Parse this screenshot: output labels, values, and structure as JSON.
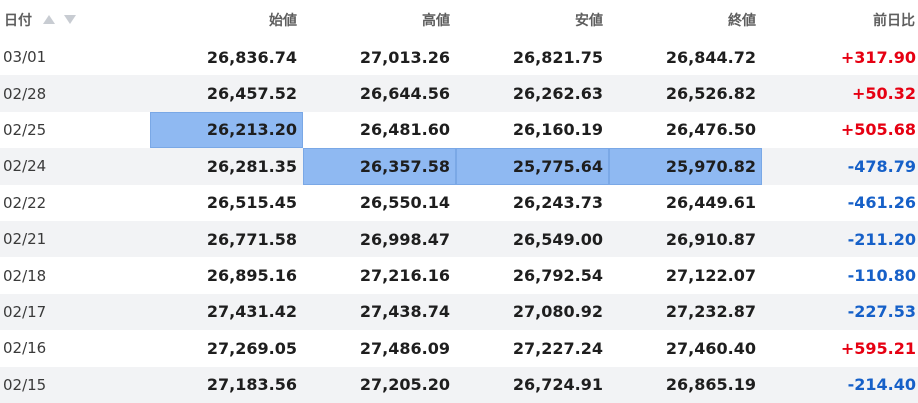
{
  "colors": {
    "up": "#e60012",
    "down": "#1660c8",
    "highlight": "#8fb9f2",
    "stripe": "#f2f3f5"
  },
  "table": {
    "headers": {
      "date": "日付",
      "open": "始値",
      "high": "高値",
      "low": "安値",
      "close": "終値",
      "change": "前日比"
    },
    "rows": [
      {
        "date": "03/01",
        "open": "26,836.74",
        "high": "27,013.26",
        "low": "26,821.75",
        "close": "26,844.72",
        "change": "+317.90",
        "direction": "up"
      },
      {
        "date": "02/28",
        "open": "26,457.52",
        "high": "26,644.56",
        "low": "26,262.63",
        "close": "26,526.82",
        "change": "+50.32",
        "direction": "up"
      },
      {
        "date": "02/25",
        "open": "26,213.20",
        "high": "26,481.60",
        "low": "26,160.19",
        "close": "26,476.50",
        "change": "+505.68",
        "direction": "up",
        "highlighted": [
          "open"
        ]
      },
      {
        "date": "02/24",
        "open": "26,281.35",
        "high": "26,357.58",
        "low": "25,775.64",
        "close": "25,970.82",
        "change": "-478.79",
        "direction": "down",
        "highlighted": [
          "high",
          "low",
          "close"
        ]
      },
      {
        "date": "02/22",
        "open": "26,515.45",
        "high": "26,550.14",
        "low": "26,243.73",
        "close": "26,449.61",
        "change": "-461.26",
        "direction": "down"
      },
      {
        "date": "02/21",
        "open": "26,771.58",
        "high": "26,998.47",
        "low": "26,549.00",
        "close": "26,910.87",
        "change": "-211.20",
        "direction": "down"
      },
      {
        "date": "02/18",
        "open": "26,895.16",
        "high": "27,216.16",
        "low": "26,792.54",
        "close": "27,122.07",
        "change": "-110.80",
        "direction": "down"
      },
      {
        "date": "02/17",
        "open": "27,431.42",
        "high": "27,438.74",
        "low": "27,080.92",
        "close": "27,232.87",
        "change": "-227.53",
        "direction": "down"
      },
      {
        "date": "02/16",
        "open": "27,269.05",
        "high": "27,486.09",
        "low": "27,227.24",
        "close": "27,460.40",
        "change": "+595.21",
        "direction": "up"
      },
      {
        "date": "02/15",
        "open": "27,183.56",
        "high": "27,205.20",
        "low": "26,724.91",
        "close": "26,865.19",
        "change": "-214.40",
        "direction": "down"
      }
    ]
  }
}
